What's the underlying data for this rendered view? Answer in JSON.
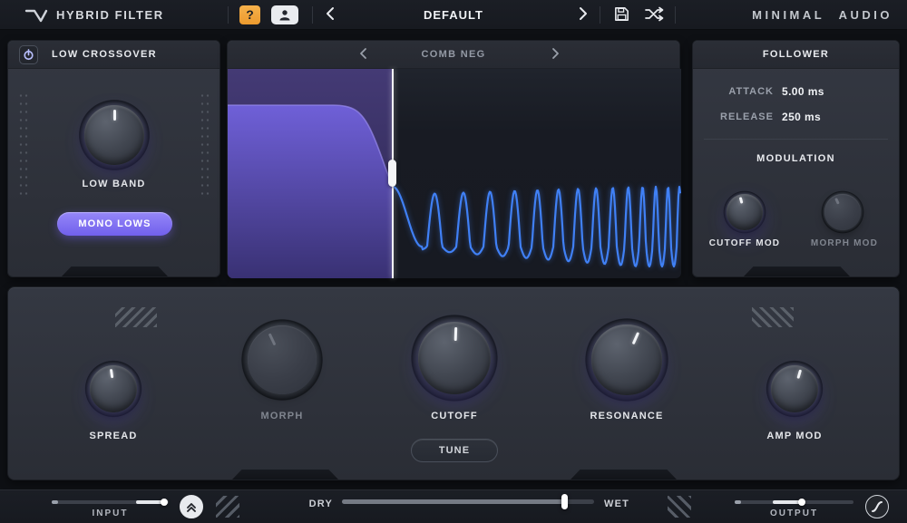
{
  "colors": {
    "accent_purple": "#7b68ee",
    "waveform_blue": "#4080f5",
    "help_orange": "#f2a33c",
    "panel_bg": "#2f333c",
    "chrome_bg": "#171a20"
  },
  "header": {
    "title": "HYBRID FILTER",
    "help_label": "?",
    "preset_name": "DEFAULT",
    "brand": "MINIMAL AUDIO",
    "icons": [
      "waveform-logo-icon",
      "user-icon",
      "chevron-left-icon",
      "chevron-right-icon",
      "save-icon",
      "shuffle-icon"
    ]
  },
  "crossover_panel": {
    "title": "LOW CROSSOVER",
    "power_icon": "power-icon",
    "knob_label": "LOW BAND",
    "mono_button": "MONO LOWS"
  },
  "filter_display": {
    "title": "COMB NEG",
    "prev_icon": "chevron-left-icon",
    "next_icon": "chevron-right-icon"
  },
  "follower_panel": {
    "title": "FOLLOWER",
    "attack_label": "ATTACK",
    "attack_value": "5.00 ms",
    "release_label": "RELEASE",
    "release_value": "250 ms",
    "modulation_title": "MODULATION",
    "cutoff_mod_label": "CUTOFF MOD",
    "morph_mod_label": "MORPH MOD"
  },
  "controls_panel": {
    "spread_label": "SPREAD",
    "morph_label": "MORPH",
    "cutoff_label": "CUTOFF",
    "resonance_label": "RESONANCE",
    "amp_mod_label": "AMP MOD",
    "tune_button": "TUNE"
  },
  "footer": {
    "input_label": "INPUT",
    "dry_label": "DRY",
    "wet_label": "WET",
    "output_label": "OUTPUT",
    "expand_icon": "chevron-up-double-icon",
    "curve_icon": "s-curve-icon"
  }
}
